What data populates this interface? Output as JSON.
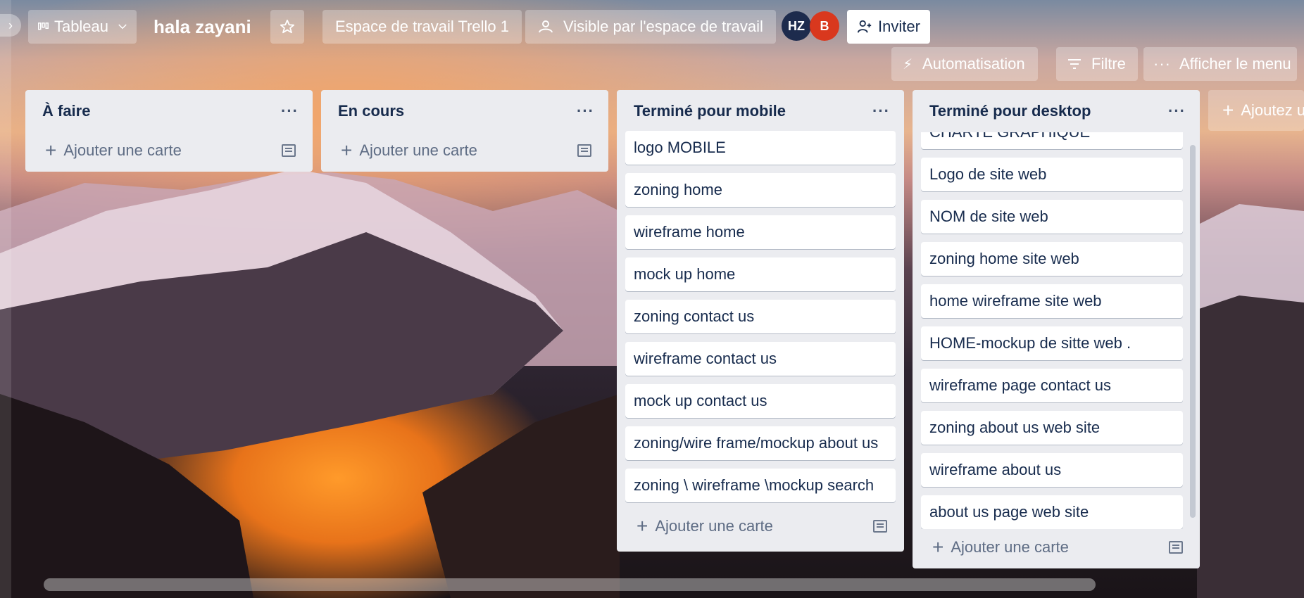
{
  "header": {
    "view_switcher": "Tableau",
    "board_title": "hala zayani",
    "workspace": "Espace de travail Trello 1",
    "visibility": "Visible par l'espace de travail",
    "members": [
      {
        "initials": "HZ",
        "color": "#1d2b4d"
      },
      {
        "initials": "B",
        "color": "#d9381e"
      }
    ],
    "invite": "Inviter",
    "automation": "Automatisation",
    "filter": "Filtre",
    "menu": "Afficher le menu"
  },
  "lists": [
    {
      "title": "À faire",
      "cards": [],
      "add_card": "Ajouter une carte"
    },
    {
      "title": "En cours",
      "cards": [],
      "add_card": "Ajouter une carte"
    },
    {
      "title": "Terminé pour mobile",
      "cards": [
        "logo MOBILE",
        "zoning home",
        "wireframe home",
        "mock up home",
        "zoning contact us",
        "wireframe contact us",
        "mock up contact us",
        "zoning/wire frame/mockup about us",
        "zoning \\ wireframe \\mockup search"
      ],
      "add_card": "Ajouter une carte"
    },
    {
      "title": "Terminé pour desktop",
      "cards": [
        "CHARTE GRAPHIQUE",
        "Logo de site web",
        "NOM de site web",
        "zoning home site web",
        "home wireframe site web",
        "HOME-mockup de sitte web .",
        "wireframe page contact us",
        "zoning about us web site",
        "wireframe about us",
        "about us page web site"
      ],
      "add_card": "Ajouter une carte"
    }
  ],
  "add_list": "Ajoutez une autre liste",
  "colors": {
    "list_bg": "#ebecf0",
    "text": "#172b4d"
  }
}
